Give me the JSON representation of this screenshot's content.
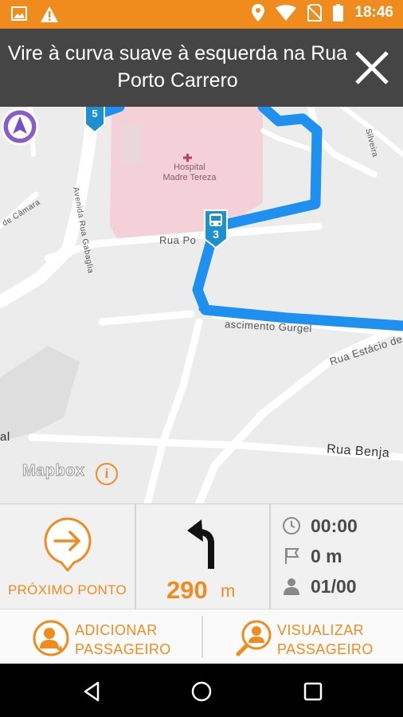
{
  "status_bar": {
    "time": "18:46",
    "left_icons": [
      "image-icon",
      "warning-icon"
    ],
    "right_icons": [
      "location-pin-icon",
      "wifi-icon",
      "no-sim-icon",
      "battery-icon"
    ],
    "color": "#f08c1e"
  },
  "instruction": {
    "text": "Vire à curva suave à esquerda na Rua Porto Carrero",
    "close_icon": "close-icon"
  },
  "map": {
    "hospital": {
      "line1": "Hospital",
      "line2": "Madre Tereza"
    },
    "street_labels": {
      "rua_porto": "Rua Po",
      "nascimento": "ascimento Gurgel",
      "estacio": "Rua Estácio de",
      "benja": "Rua Benja",
      "avenida": "Avenida Rua Gabaglia",
      "camara": "de Câmara",
      "silveira": "Silveira",
      "al": "al"
    },
    "bus_stops": [
      {
        "number": "5"
      },
      {
        "number": "3"
      }
    ],
    "attribution": "Mapbox",
    "info_symbol": "i",
    "route_color": "#1e90f0"
  },
  "panel": {
    "next_stop_label": "PRÓXIMO PONTO",
    "distance_value": "290",
    "distance_unit": "m",
    "stats": {
      "time": "00:00",
      "distance": "0 m",
      "passengers": "01/00"
    }
  },
  "actions": {
    "add_passenger": {
      "line1": "ADICIONAR",
      "line2": "PASSAGEIRO"
    },
    "view_passenger": {
      "line1": "VISUALIZAR",
      "line2": "PASSAGEIRO"
    }
  },
  "accent_color": "#f08c1e"
}
